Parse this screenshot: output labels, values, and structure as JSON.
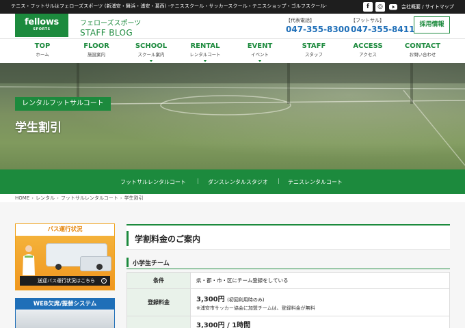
{
  "top_bar": {
    "tagline": "テニス・フットサルはフェローズスポーツ (新浦安・舞浜・浦安・葛西) -テニススクール・サッカースクール・テニスショップ・ゴルフスクール-",
    "links": "会社概要 / サイトマップ",
    "social": [
      {
        "icon": "facebook-icon",
        "glyph": "f"
      },
      {
        "icon": "instagram-icon",
        "glyph": "◎"
      },
      {
        "icon": "youtube-icon"
      }
    ]
  },
  "header": {
    "logo_main": "fellows",
    "logo_sub": "SPORTS",
    "brand_jp": "フェローズスポーツ",
    "brand_en": "STAFF BLOG",
    "phones": [
      {
        "label": "【代表電話】",
        "number": "047-355-8300"
      },
      {
        "label": "【フットサル】",
        "number": "047-355-8411"
      }
    ],
    "recruit_label": "採用情報"
  },
  "nav": {
    "items": [
      {
        "en": "TOP",
        "jp": "ホーム",
        "has_dropdown": false
      },
      {
        "en": "FLOOR",
        "jp": "施設案内",
        "has_dropdown": false
      },
      {
        "en": "SCHOOL",
        "jp": "スクール案内",
        "has_dropdown": true
      },
      {
        "en": "RENTAL",
        "jp": "レンタルコート",
        "has_dropdown": true
      },
      {
        "en": "EVENT",
        "jp": "イベント",
        "has_dropdown": true
      },
      {
        "en": "STAFF",
        "jp": "スタッフ",
        "has_dropdown": false
      },
      {
        "en": "ACCESS",
        "jp": "アクセス",
        "has_dropdown": false
      },
      {
        "en": "CONTACT",
        "jp": "お問い合わせ",
        "has_dropdown": false
      }
    ]
  },
  "hero": {
    "tag": "レンタルフットサルコート",
    "title": "学生割引"
  },
  "subnav": {
    "items": [
      "フットサルレンタルコート",
      "ダンスレンタルスタジオ",
      "テニスレンタルコート"
    ]
  },
  "breadcrumb": [
    "HOME",
    "レンタル",
    "フットサルレンタルコート",
    "学生割引"
  ],
  "sidebar": {
    "bus_title": "バス運行状況",
    "bus_cta": "送迎バス運行状況はこちら",
    "web_title": "WEB欠席/振替システム"
  },
  "main": {
    "heading": "学割料金のご案内",
    "section": "小学生チーム",
    "table": {
      "condition_label": "条件",
      "condition_value": "県・都・市・区にチーム登録をしている",
      "fee_label": "登録料金",
      "fee_price": "3,300円",
      "fee_price_note": "(初回利用時のみ)",
      "fee_note": "※浦安市サッカー協会に加盟チームは、登録料金が無料",
      "hour_price": "3,300円 / 1時間"
    }
  },
  "colors": {
    "brand_green": "#1c8a3d",
    "phone_blue": "#1f6fb8",
    "bus_orange": "#f0961f",
    "top_bar": "#1e1e1e"
  }
}
